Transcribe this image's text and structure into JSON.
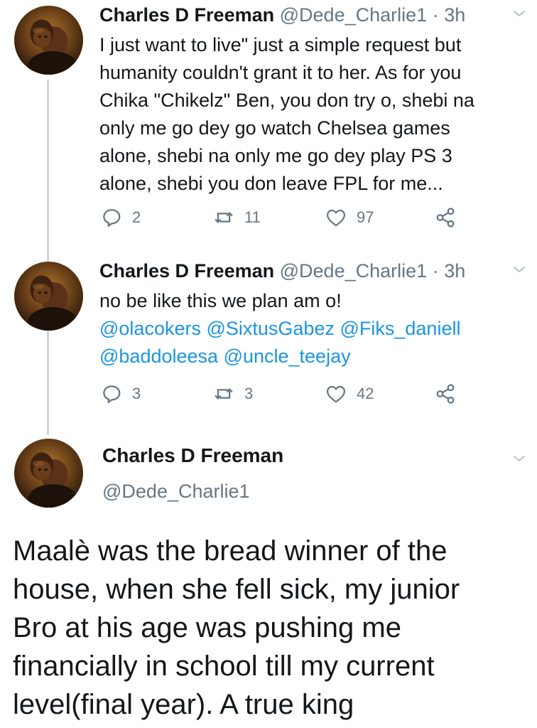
{
  "tweets": [
    {
      "name": "Charles D Freeman",
      "handle": "@Dede_Charlie1",
      "time": "3h",
      "body_lines": [
        "I just want to live\" just a simple request but",
        "humanity couldn't grant it to her. As for you",
        "Chika \"Chikelz\" Ben, you don try o, shebi na",
        "only me go dey go watch Chelsea games",
        "alone, shebi na only me go dey play PS 3",
        "alone, shebi you don leave FPL for me..."
      ],
      "replies": "2",
      "retweets": "11",
      "likes": "97"
    },
    {
      "name": "Charles D Freeman",
      "handle": "@Dede_Charlie1",
      "time": "3h",
      "body_line": "no be like this we plan am o!",
      "mentions": [
        "@olacokers",
        "@SixtusGabez",
        "@Fiks_daniell",
        "@baddoleesa",
        "@uncle_teejay"
      ],
      "replies": "3",
      "retweets": "3",
      "likes": "42"
    }
  ],
  "main_tweet": {
    "name": "Charles D Freeman",
    "handle": "@Dede_Charlie1",
    "text_lines": [
      "Maalè was the bread winner of the",
      "house, when she fell sick, my junior",
      "Bro at his age was pushing me",
      "financially in school till my current",
      "level(final year). A true king"
    ]
  },
  "separator": "·",
  "icons": [
    "reply-icon",
    "retweet-icon",
    "like-icon",
    "share-icon",
    "chevron-down-icon"
  ],
  "colors": {
    "text": "#14171a",
    "muted": "#657786",
    "link": "#1b95e0",
    "thread": "#ccd6dd"
  }
}
